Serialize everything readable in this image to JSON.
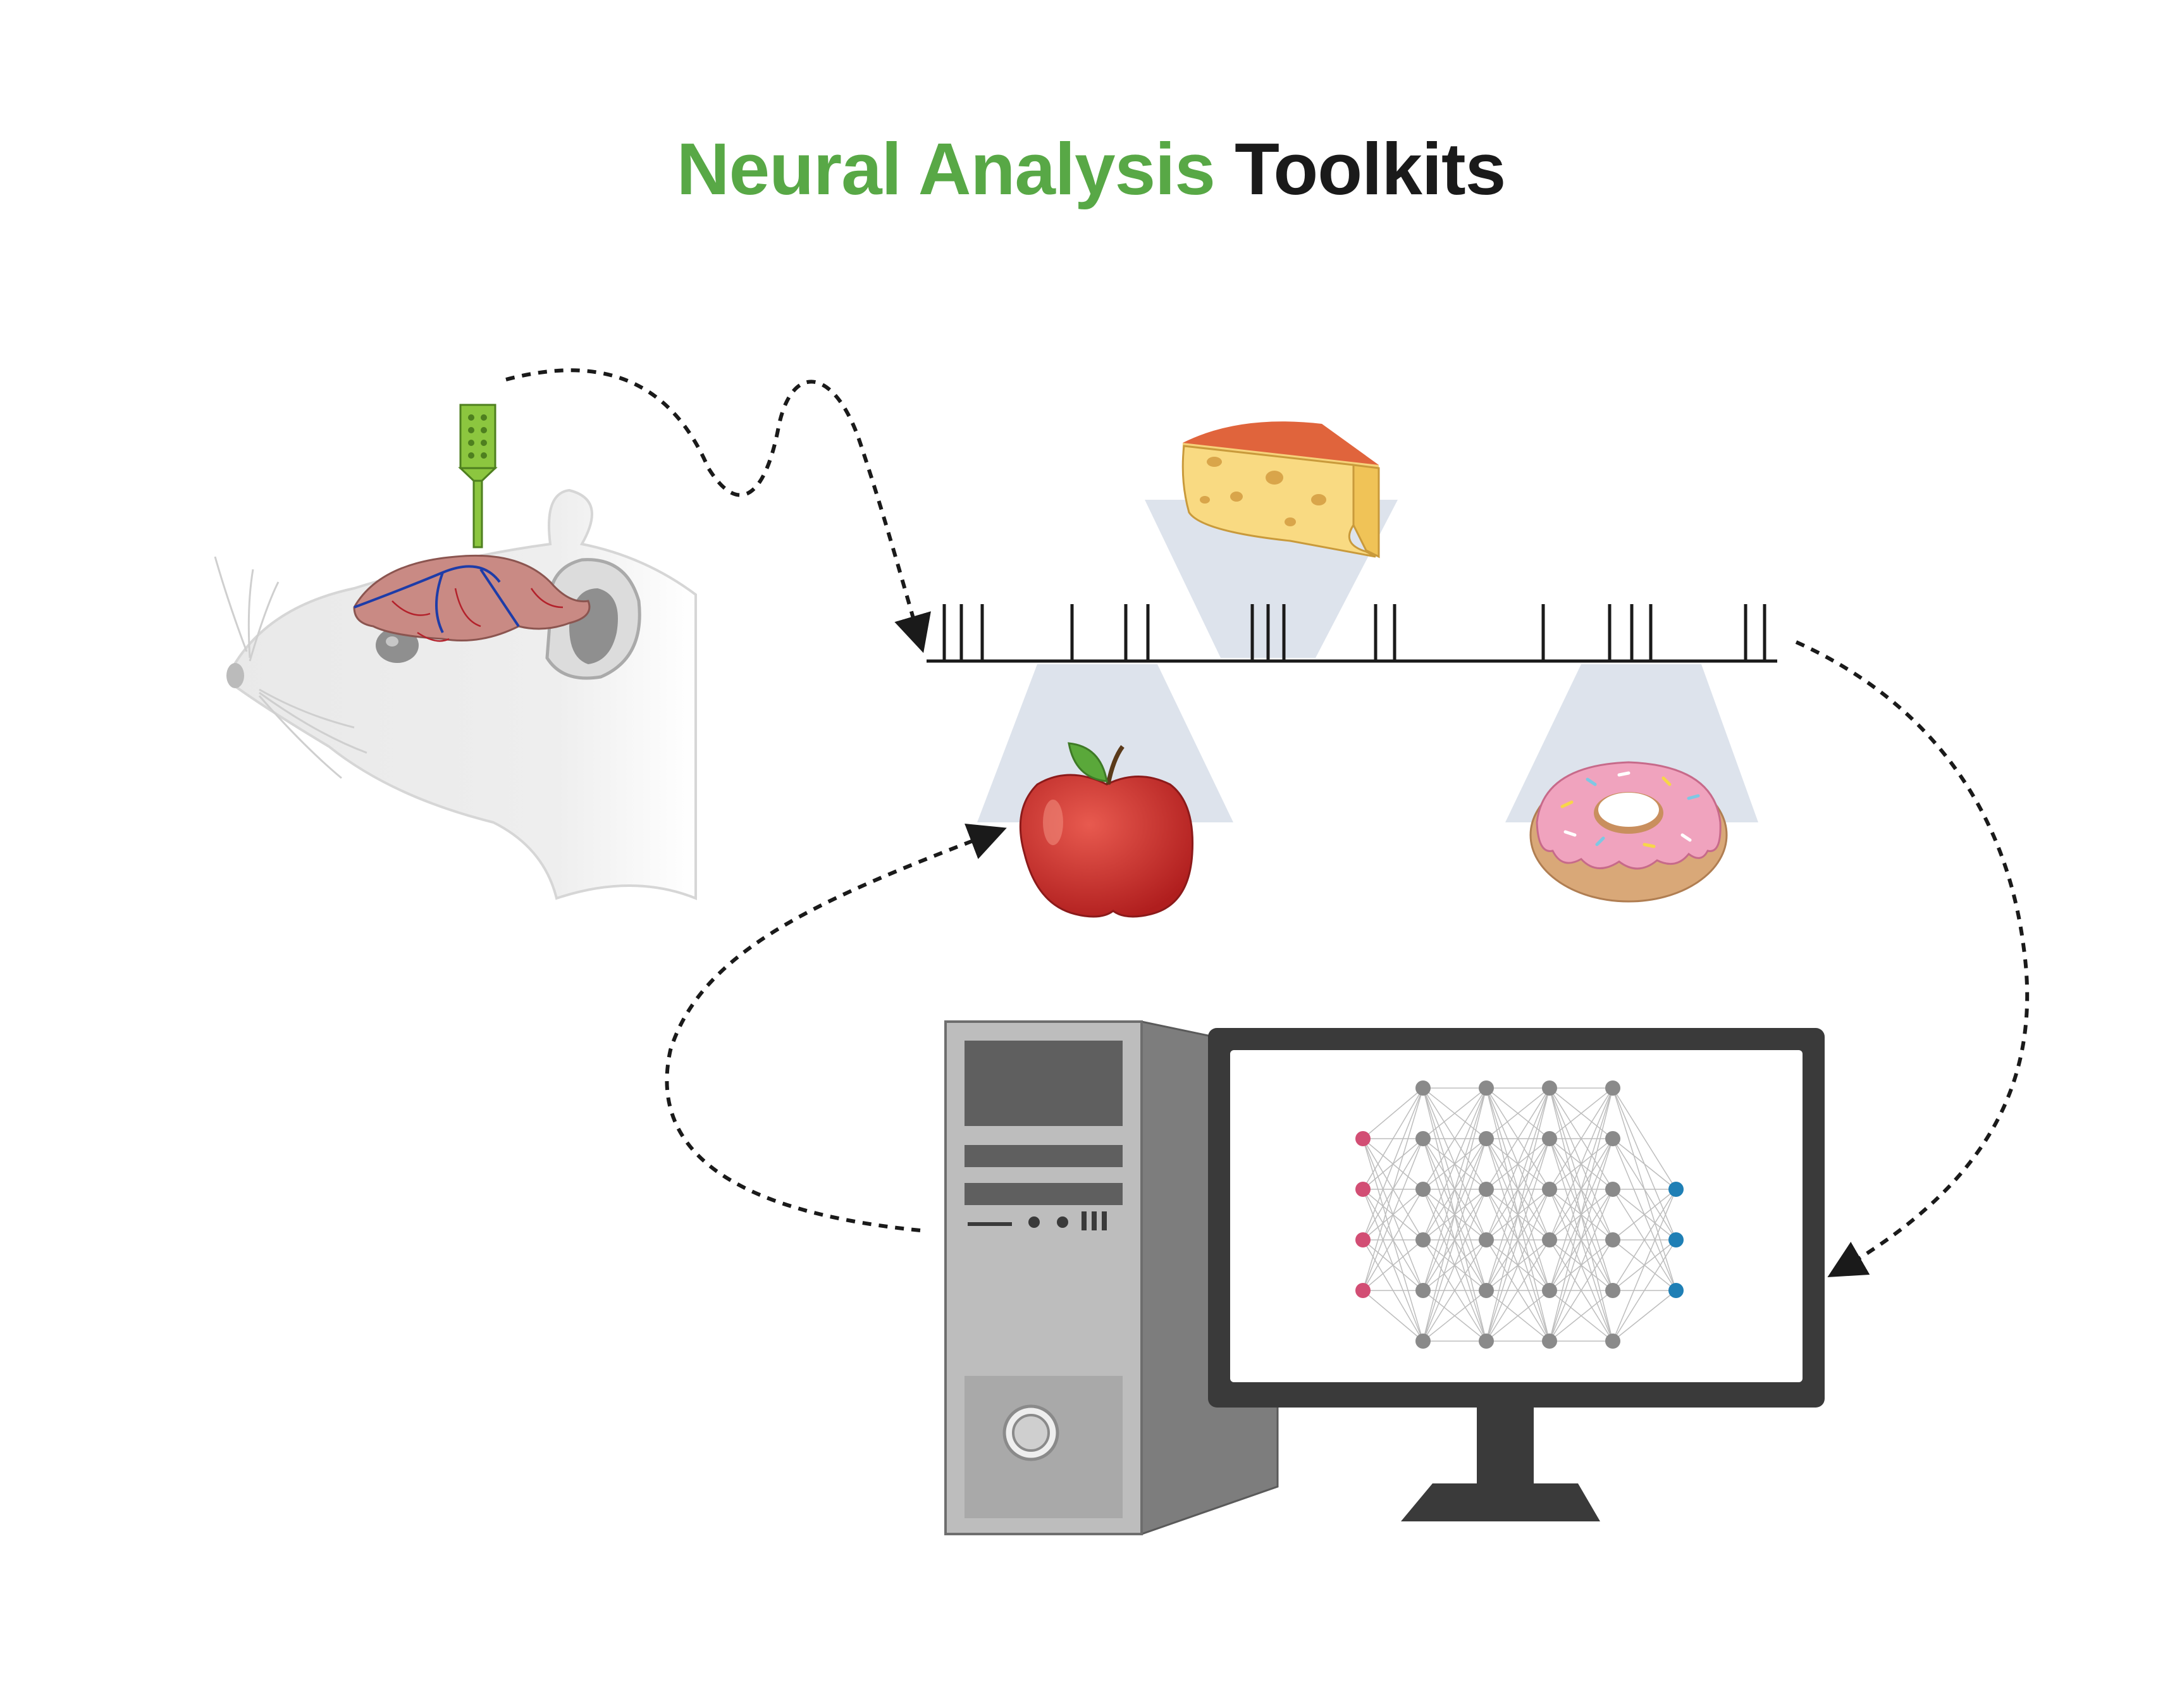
{
  "title": {
    "part1": "Neural Analysis",
    "part2": "Toolkits",
    "color_part1": "#58a846",
    "color_part2": "#1a1a1a"
  },
  "colors": {
    "arrow": "#1a1a1a",
    "beam": "#dde3ec",
    "probe": "#8cc63f",
    "brain": "#c98a84",
    "input_node": "#d24e74",
    "hidden_node": "#8a8a8a",
    "output_node": "#1f7fb5"
  },
  "icons": [
    "mouse-with-implanted-probe",
    "spike-train",
    "cheese-icon",
    "apple-icon",
    "donut-icon",
    "computer-tower-icon",
    "monitor-icon",
    "neural-network-icon"
  ]
}
